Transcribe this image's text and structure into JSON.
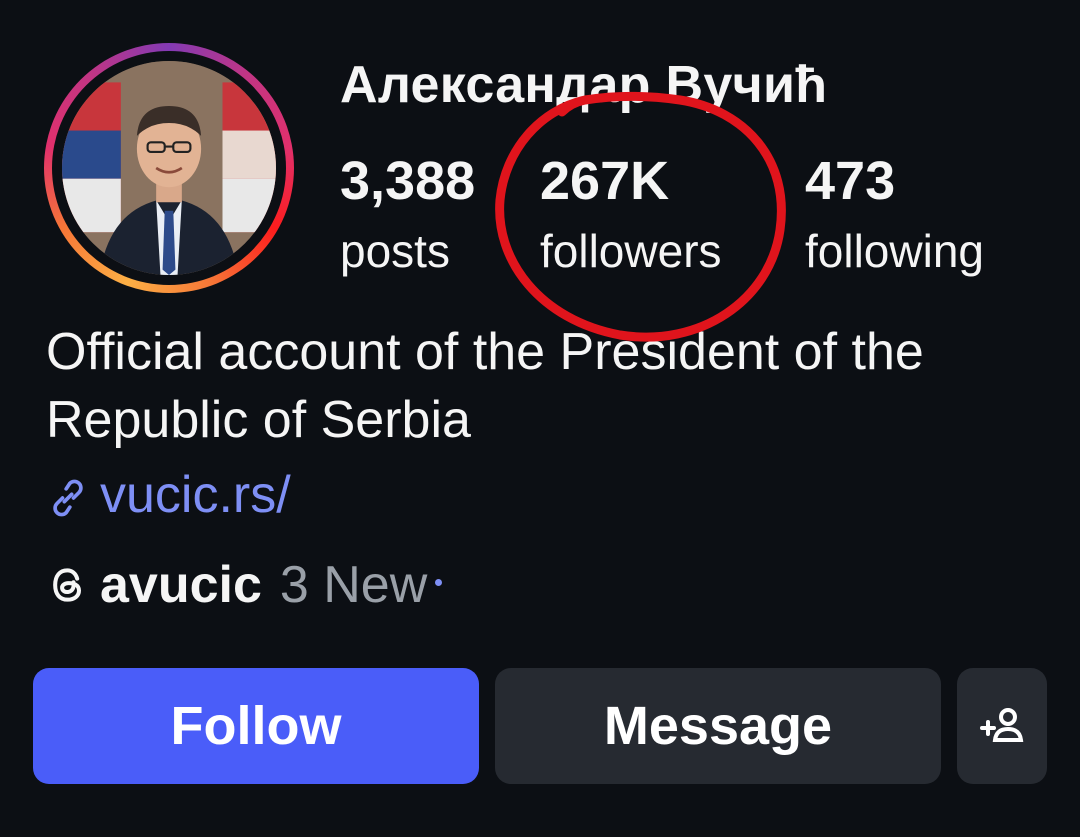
{
  "profile": {
    "username": "Александар Вучић",
    "avatar_icon": "profile-photo",
    "stats": {
      "posts_count": "3,388",
      "posts_label": "posts",
      "followers_count": "267K",
      "followers_label": "followers",
      "following_count": "473",
      "following_label": "following"
    },
    "bio": "Official account of the President of the Republic of Serbia",
    "link": {
      "icon": "link-icon",
      "text": "vucic.rs/"
    },
    "threads": {
      "icon": "threads-icon",
      "handle": "avucic",
      "new_label": "3 New"
    }
  },
  "actions": {
    "follow_label": "Follow",
    "message_label": "Message",
    "add_user_icon": "add-person-icon"
  },
  "colors": {
    "background": "#0c0f14",
    "follow_button": "#4a5df9",
    "secondary_button": "#262a31",
    "link": "#7e8ff5",
    "annotation_circle": "#e0141c"
  }
}
